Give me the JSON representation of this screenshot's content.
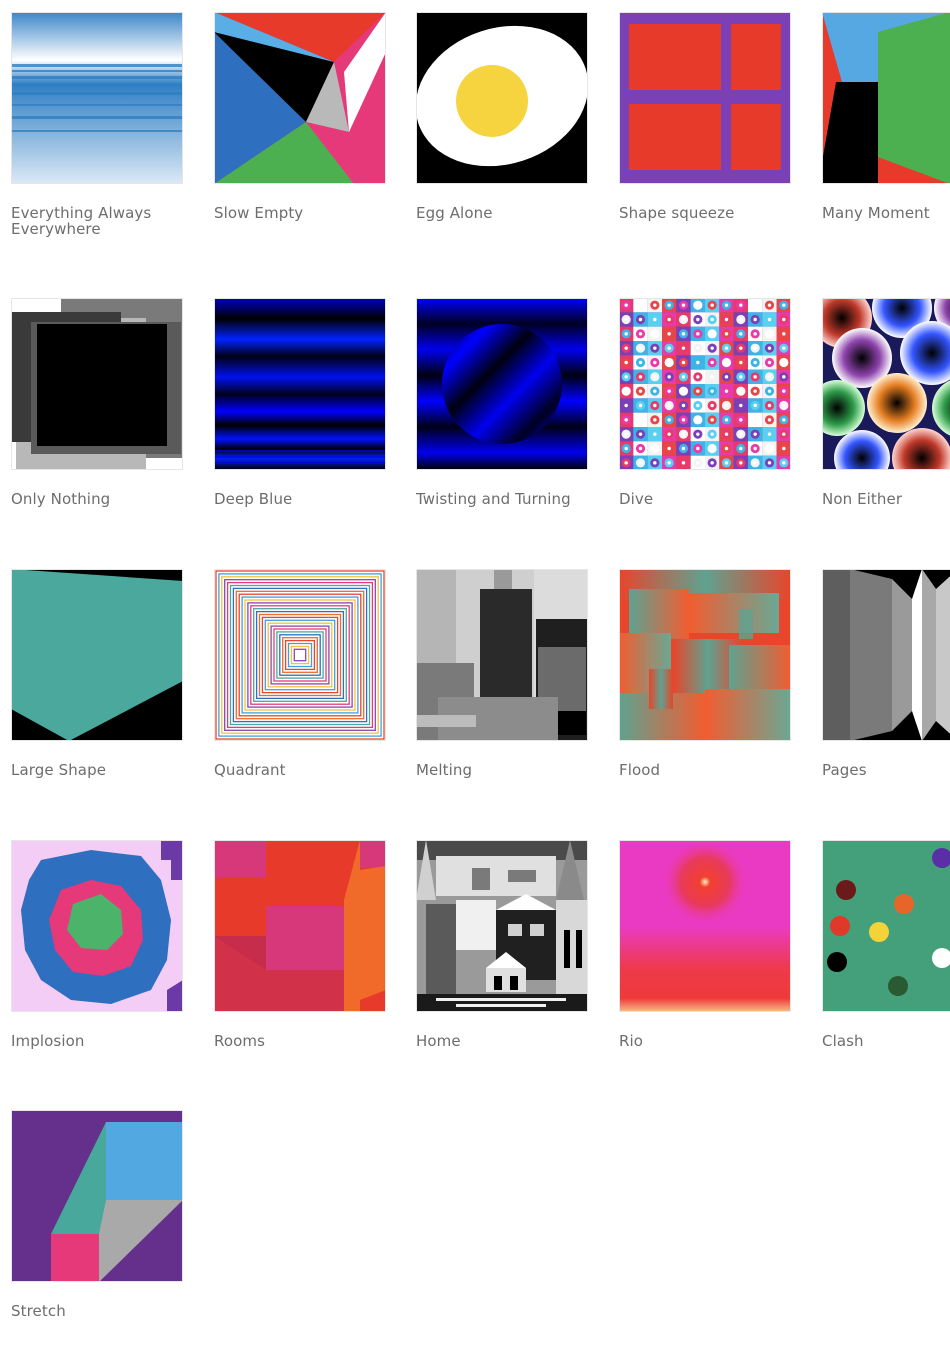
{
  "gallery": {
    "items": [
      {
        "title": "Everything Always Everywhere"
      },
      {
        "title": "Slow Empty"
      },
      {
        "title": "Egg Alone"
      },
      {
        "title": "Shape squeeze"
      },
      {
        "title": "Many Moment"
      },
      {
        "title": "Only Nothing"
      },
      {
        "title": "Deep Blue"
      },
      {
        "title": "Twisting and Turning"
      },
      {
        "title": "Dive"
      },
      {
        "title": "Non Either"
      },
      {
        "title": "Large Shape"
      },
      {
        "title": "Quadrant"
      },
      {
        "title": "Melting"
      },
      {
        "title": "Flood"
      },
      {
        "title": "Pages"
      },
      {
        "title": "Implosion"
      },
      {
        "title": "Rooms"
      },
      {
        "title": "Home"
      },
      {
        "title": "Rio"
      },
      {
        "title": "Clash"
      },
      {
        "title": "Stretch"
      }
    ]
  }
}
